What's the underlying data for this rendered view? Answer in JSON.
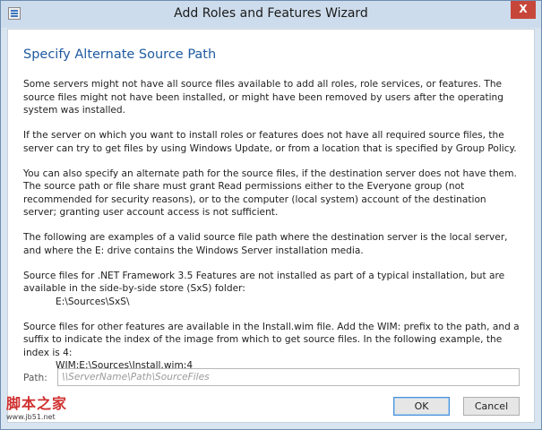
{
  "window": {
    "title": "Add Roles and Features Wizard",
    "close_glyph": "X"
  },
  "page": {
    "heading": "Specify Alternate Source Path",
    "paragraphs": {
      "p1": "Some servers might not have all source files available to add all roles, role services, or features. The source files might not have been installed, or might have been removed by users after the operating system was installed.",
      "p2": "If the server on which you want to install roles or features does not have all required source files, the server can try to get files by using Windows Update, or from a location that is specified by Group Policy.",
      "p3": "You can also specify an alternate path for the source files, if the destination server does not have them. The source path or file share must grant Read permissions either to the Everyone group (not recommended for security reasons), or to the computer (local system) account of the destination server; granting user account access is not sufficient.",
      "p4": "The following are examples of a valid source file path where the destination server is the local server, and where the E: drive contains the Windows Server installation media.",
      "p5": "Source files for .NET Framework 3.5 Features are not installed as part of a typical installation, but are available in the side-by-side store (SxS) folder:",
      "p5_example": "E:\\Sources\\SxS\\",
      "p6": "Source files for other features are available in the Install.wim file. Add the WIM: prefix to the path, and a suffix to indicate the index of the image from which to get source files. In the following example, the index is 4:",
      "p6_example": "WIM:E:\\Sources\\Install.wim:4"
    }
  },
  "path_field": {
    "label": "Path:",
    "value": "",
    "placeholder": "\\\\ServerName\\Path\\SourceFiles"
  },
  "buttons": {
    "ok": "OK",
    "cancel": "Cancel"
  },
  "watermark": {
    "main": "脚本之家",
    "url": "www.jb51.net"
  },
  "colors": {
    "heading": "#1f5aa0",
    "close_button": "#c7463a",
    "frame": "#d8e4f0",
    "watermark": "#d03030"
  },
  "icons": {
    "app": "server-manager-icon",
    "close": "close-icon"
  }
}
